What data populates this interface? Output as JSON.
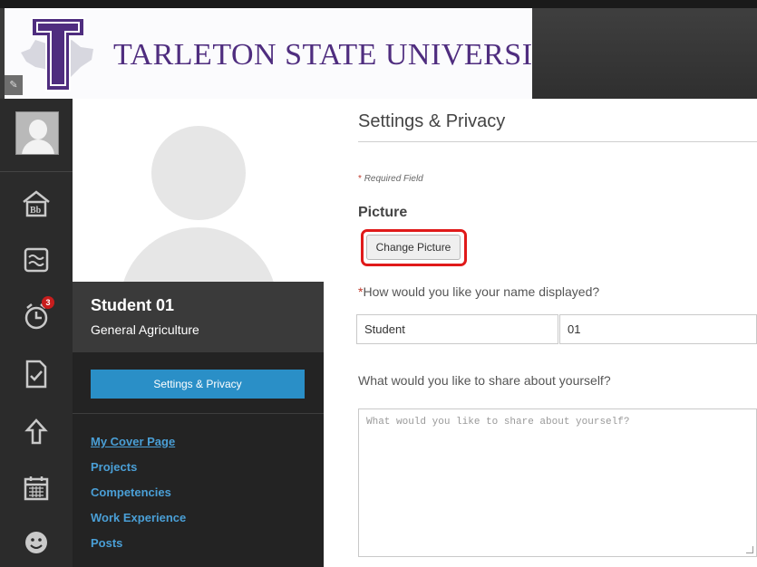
{
  "header": {
    "university_name": "TARLETON STATE UNIVERSITY",
    "logo_icon": "tarleton-t-logo",
    "edit_icon": "pencil-icon",
    "brand_color": "#4f2d7f"
  },
  "icon_nav": {
    "items": [
      {
        "name": "avatar"
      },
      {
        "name": "institution-page-icon"
      },
      {
        "name": "activity-stream-icon"
      },
      {
        "name": "due-dates-icon",
        "badge": "3"
      },
      {
        "name": "grades-icon"
      },
      {
        "name": "portfolio-icon"
      },
      {
        "name": "calendar-icon"
      },
      {
        "name": "smiley-icon"
      }
    ]
  },
  "profile": {
    "name": "Student 01",
    "department": "General Agriculture",
    "settings_button": "Settings & Privacy",
    "links": [
      "My Cover Page",
      "Projects",
      "Competencies",
      "Work Experience",
      "Posts"
    ]
  },
  "main": {
    "title": "Settings & Privacy",
    "required_marker": "*",
    "required_text": "Required Field",
    "picture_heading": "Picture",
    "change_picture_label": "Change Picture",
    "name_question": "How would you like your name displayed?",
    "first_name_value": "Student",
    "last_name_value": "01",
    "about_question": "What would you like to share about yourself?",
    "about_placeholder": "What would you like to share about yourself?",
    "highlight_color": "#e01a1a"
  }
}
